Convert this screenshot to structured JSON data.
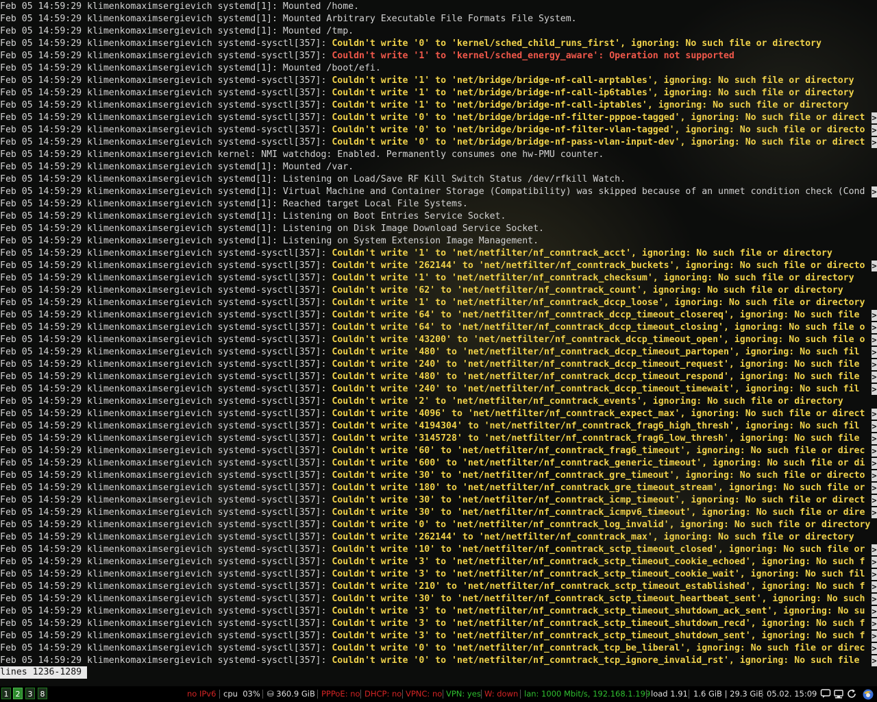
{
  "log": {
    "prefix": "Feb 05 14:59:29 klimenkomaximsergievich ",
    "lines": [
      {
        "source": "systemd[1]: ",
        "msg": "Mounted /home.",
        "level": "info"
      },
      {
        "source": "systemd[1]: ",
        "msg": "Mounted Arbitrary Executable File Formats File System.",
        "level": "info"
      },
      {
        "source": "systemd[1]: ",
        "msg": "Mounted /tmp.",
        "level": "info"
      },
      {
        "source": "systemd-sysctl[357]: ",
        "msg": "Couldn't write '0' to 'kernel/sched_child_runs_first', ignoring: No such file or directory",
        "level": "warn"
      },
      {
        "source": "systemd-sysctl[357]: ",
        "msg": "Couldn't write '1' to 'kernel/sched_energy_aware': Operation not supported",
        "level": "error"
      },
      {
        "source": "systemd[1]: ",
        "msg": "Mounted /boot/efi.",
        "level": "info"
      },
      {
        "source": "systemd-sysctl[357]: ",
        "msg": "Couldn't write '1' to 'net/bridge/bridge-nf-call-arptables', ignoring: No such file or directory",
        "level": "warn"
      },
      {
        "source": "systemd-sysctl[357]: ",
        "msg": "Couldn't write '1' to 'net/bridge/bridge-nf-call-ip6tables', ignoring: No such file or directory",
        "level": "warn"
      },
      {
        "source": "systemd-sysctl[357]: ",
        "msg": "Couldn't write '1' to 'net/bridge/bridge-nf-call-iptables', ignoring: No such file or directory",
        "level": "warn"
      },
      {
        "source": "systemd-sysctl[357]: ",
        "msg": "Couldn't write '0' to 'net/bridge/bridge-nf-filter-pppoe-tagged', ignoring: No such file or direct",
        "level": "warn",
        "truncated": true
      },
      {
        "source": "systemd-sysctl[357]: ",
        "msg": "Couldn't write '0' to 'net/bridge/bridge-nf-filter-vlan-tagged', ignoring: No such file or directo",
        "level": "warn",
        "truncated": true
      },
      {
        "source": "systemd-sysctl[357]: ",
        "msg": "Couldn't write '0' to 'net/bridge/bridge-nf-pass-vlan-input-dev', ignoring: No such file or direct",
        "level": "warn",
        "truncated": true
      },
      {
        "source": "kernel: ",
        "msg": "NMI watchdog: Enabled. Permanently consumes one hw-PMU counter.",
        "level": "info"
      },
      {
        "source": "systemd[1]: ",
        "msg": "Mounted /var.",
        "level": "info"
      },
      {
        "source": "systemd[1]: ",
        "msg": "Listening on Load/Save RF Kill Switch Status /dev/rfkill Watch.",
        "level": "info"
      },
      {
        "source": "systemd[1]: ",
        "msg": "Virtual Machine and Container Storage (Compatibility) was skipped because of an unmet condition check (Cond",
        "level": "info",
        "truncated": true
      },
      {
        "source": "systemd[1]: ",
        "msg": "Reached target Local File Systems.",
        "level": "info"
      },
      {
        "source": "systemd[1]: ",
        "msg": "Listening on Boot Entries Service Socket.",
        "level": "info"
      },
      {
        "source": "systemd[1]: ",
        "msg": "Listening on Disk Image Download Service Socket.",
        "level": "info"
      },
      {
        "source": "systemd[1]: ",
        "msg": "Listening on System Extension Image Management.",
        "level": "info"
      },
      {
        "source": "systemd-sysctl[357]: ",
        "msg": "Couldn't write '1' to 'net/netfilter/nf_conntrack_acct', ignoring: No such file or directory",
        "level": "warn"
      },
      {
        "source": "systemd-sysctl[357]: ",
        "msg": "Couldn't write '262144' to 'net/netfilter/nf_conntrack_buckets', ignoring: No such file or directo",
        "level": "warn",
        "truncated": true
      },
      {
        "source": "systemd-sysctl[357]: ",
        "msg": "Couldn't write '1' to 'net/netfilter/nf_conntrack_checksum', ignoring: No such file or directory",
        "level": "warn"
      },
      {
        "source": "systemd-sysctl[357]: ",
        "msg": "Couldn't write '62' to 'net/netfilter/nf_conntrack_count', ignoring: No such file or directory",
        "level": "warn"
      },
      {
        "source": "systemd-sysctl[357]: ",
        "msg": "Couldn't write '1' to 'net/netfilter/nf_conntrack_dccp_loose', ignoring: No such file or directory",
        "level": "warn"
      },
      {
        "source": "systemd-sysctl[357]: ",
        "msg": "Couldn't write '64' to 'net/netfilter/nf_conntrack_dccp_timeout_closereq', ignoring: No such file ",
        "level": "warn",
        "truncated": true
      },
      {
        "source": "systemd-sysctl[357]: ",
        "msg": "Couldn't write '64' to 'net/netfilter/nf_conntrack_dccp_timeout_closing', ignoring: No such file o",
        "level": "warn",
        "truncated": true
      },
      {
        "source": "systemd-sysctl[357]: ",
        "msg": "Couldn't write '43200' to 'net/netfilter/nf_conntrack_dccp_timeout_open', ignoring: No such file o",
        "level": "warn",
        "truncated": true
      },
      {
        "source": "systemd-sysctl[357]: ",
        "msg": "Couldn't write '480' to 'net/netfilter/nf_conntrack_dccp_timeout_partopen', ignoring: No such fil",
        "level": "warn",
        "truncated": true
      },
      {
        "source": "systemd-sysctl[357]: ",
        "msg": "Couldn't write '240' to 'net/netfilter/nf_conntrack_dccp_timeout_request', ignoring: No such file ",
        "level": "warn",
        "truncated": true
      },
      {
        "source": "systemd-sysctl[357]: ",
        "msg": "Couldn't write '480' to 'net/netfilter/nf_conntrack_dccp_timeout_respond', ignoring: No such file ",
        "level": "warn",
        "truncated": true
      },
      {
        "source": "systemd-sysctl[357]: ",
        "msg": "Couldn't write '240' to 'net/netfilter/nf_conntrack_dccp_timeout_timewait', ignoring: No such fil",
        "level": "warn",
        "truncated": true
      },
      {
        "source": "systemd-sysctl[357]: ",
        "msg": "Couldn't write '2' to 'net/netfilter/nf_conntrack_events', ignoring: No such file or directory",
        "level": "warn"
      },
      {
        "source": "systemd-sysctl[357]: ",
        "msg": "Couldn't write '4096' to 'net/netfilter/nf_conntrack_expect_max', ignoring: No such file or direct",
        "level": "warn",
        "truncated": true
      },
      {
        "source": "systemd-sysctl[357]: ",
        "msg": "Couldn't write '4194304' to 'net/netfilter/nf_conntrack_frag6_high_thresh', ignoring: No such fil",
        "level": "warn",
        "truncated": true
      },
      {
        "source": "systemd-sysctl[357]: ",
        "msg": "Couldn't write '3145728' to 'net/netfilter/nf_conntrack_frag6_low_thresh', ignoring: No such file ",
        "level": "warn",
        "truncated": true
      },
      {
        "source": "systemd-sysctl[357]: ",
        "msg": "Couldn't write '60' to 'net/netfilter/nf_conntrack_frag6_timeout', ignoring: No such file or direc",
        "level": "warn",
        "truncated": true
      },
      {
        "source": "systemd-sysctl[357]: ",
        "msg": "Couldn't write '600' to 'net/netfilter/nf_conntrack_generic_timeout', ignoring: No such file or di",
        "level": "warn",
        "truncated": true
      },
      {
        "source": "systemd-sysctl[357]: ",
        "msg": "Couldn't write '30' to 'net/netfilter/nf_conntrack_gre_timeout', ignoring: No such file or directo",
        "level": "warn",
        "truncated": true
      },
      {
        "source": "systemd-sysctl[357]: ",
        "msg": "Couldn't write '180' to 'net/netfilter/nf_conntrack_gre_timeout_stream', ignoring: No such file or",
        "level": "warn",
        "truncated": true
      },
      {
        "source": "systemd-sysctl[357]: ",
        "msg": "Couldn't write '30' to 'net/netfilter/nf_conntrack_icmp_timeout', ignoring: No such file or direct",
        "level": "warn",
        "truncated": true
      },
      {
        "source": "systemd-sysctl[357]: ",
        "msg": "Couldn't write '30' to 'net/netfilter/nf_conntrack_icmpv6_timeout', ignoring: No such file or dire",
        "level": "warn",
        "truncated": true
      },
      {
        "source": "systemd-sysctl[357]: ",
        "msg": "Couldn't write '0' to 'net/netfilter/nf_conntrack_log_invalid', ignoring: No such file or directory",
        "level": "warn"
      },
      {
        "source": "systemd-sysctl[357]: ",
        "msg": "Couldn't write '262144' to 'net/netfilter/nf_conntrack_max', ignoring: No such file or directory",
        "level": "warn"
      },
      {
        "source": "systemd-sysctl[357]: ",
        "msg": "Couldn't write '10' to 'net/netfilter/nf_conntrack_sctp_timeout_closed', ignoring: No such file or",
        "level": "warn",
        "truncated": true
      },
      {
        "source": "systemd-sysctl[357]: ",
        "msg": "Couldn't write '3' to 'net/netfilter/nf_conntrack_sctp_timeout_cookie_echoed', ignoring: No such f",
        "level": "warn",
        "truncated": true
      },
      {
        "source": "systemd-sysctl[357]: ",
        "msg": "Couldn't write '3' to 'net/netfilter/nf_conntrack_sctp_timeout_cookie_wait', ignoring: No such fil",
        "level": "warn",
        "truncated": true
      },
      {
        "source": "systemd-sysctl[357]: ",
        "msg": "Couldn't write '210' to 'net/netfilter/nf_conntrack_sctp_timeout_established', ignoring: No such f",
        "level": "warn",
        "truncated": true
      },
      {
        "source": "systemd-sysctl[357]: ",
        "msg": "Couldn't write '30' to 'net/netfilter/nf_conntrack_sctp_timeout_heartbeat_sent', ignoring: No such",
        "level": "warn",
        "truncated": true
      },
      {
        "source": "systemd-sysctl[357]: ",
        "msg": "Couldn't write '3' to 'net/netfilter/nf_conntrack_sctp_timeout_shutdown_ack_sent', ignoring: No su",
        "level": "warn",
        "truncated": true
      },
      {
        "source": "systemd-sysctl[357]: ",
        "msg": "Couldn't write '3' to 'net/netfilter/nf_conntrack_sctp_timeout_shutdown_recd', ignoring: No such f",
        "level": "warn",
        "truncated": true
      },
      {
        "source": "systemd-sysctl[357]: ",
        "msg": "Couldn't write '3' to 'net/netfilter/nf_conntrack_sctp_timeout_shutdown_sent', ignoring: No such f",
        "level": "warn",
        "truncated": true
      },
      {
        "source": "systemd-sysctl[357]: ",
        "msg": "Couldn't write '0' to 'net/netfilter/nf_conntrack_tcp_be_liberal', ignoring: No such file or direc",
        "level": "warn",
        "truncated": true
      },
      {
        "source": "systemd-sysctl[357]: ",
        "msg": "Couldn't write '0' to 'net/netfilter/nf_conntrack_tcp_ignore_invalid_rst', ignoring: No such file ",
        "level": "warn",
        "truncated": true
      }
    ],
    "truncation_marker": ">"
  },
  "pager": {
    "status": "lines 1236-1289"
  },
  "statusbar": {
    "workspaces": [
      {
        "label": "1",
        "focused": false
      },
      {
        "label": "2",
        "focused": true
      },
      {
        "label": "3",
        "focused": false
      },
      {
        "label": "8",
        "focused": false
      }
    ],
    "items": {
      "ipv6": "no IPv6",
      "cpu": "cpu  03%",
      "disk": "⛁ 360.9 GiB",
      "pppoe": "PPPoE: no",
      "dhcp": "DHCP: no",
      "vpnc": "VPNC: no",
      "vpn": "VPN: yes",
      "wireless": "W: down",
      "lan": "lan: 1000 Mbit/s, 192.168.1.199",
      "load": "load 1.91",
      "memory": "1.6 GiB | 29.3 GiB",
      "datetime": "05.02. 15:09"
    },
    "colors": {
      "bad": "#d42424",
      "good": "#2fbf2f",
      "neutral": "#e0e0e0"
    },
    "tray_icons": [
      "chat-icon",
      "network-icon",
      "update-icon",
      "browser-icon"
    ]
  },
  "colors": {
    "info_text": "#d3d3d3",
    "warn_text": "#f0d24a",
    "error_text": "#f0584a"
  }
}
